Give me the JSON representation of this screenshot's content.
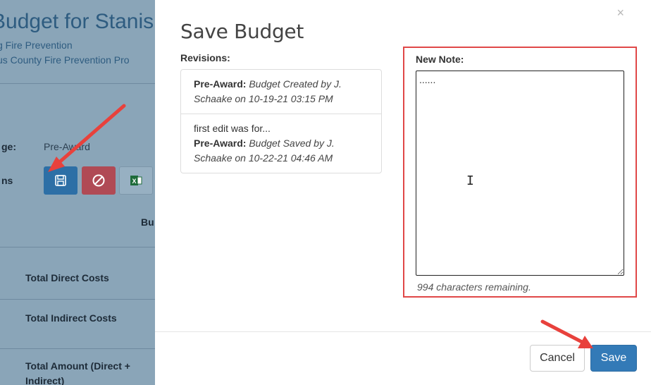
{
  "background": {
    "title": "Budget for Stanisl",
    "subtitle1": "g Fire Prevention",
    "subtitle2": "us County Fire Prevention Pro",
    "stage_label": "ge:",
    "stage_value": "Pre-Award",
    "actions_label": "ns",
    "column_header": "Bu",
    "rows": [
      "Total Direct Costs",
      "Total Indirect Costs",
      "Total Amount (Direct + Indirect)"
    ]
  },
  "modal": {
    "close": "×",
    "title": "Save Budget",
    "revisions_label": "Revisions:",
    "revisions": [
      {
        "note": "",
        "stage": "Pre-Award:",
        "text": "Budget Created by J. Schaake on 10-19-21 03:15 PM"
      },
      {
        "note": "first edit was for...",
        "stage": "Pre-Award:",
        "text": "Budget Saved by J. Schaake on 10-22-21 04:46 AM"
      }
    ],
    "new_note_label": "New Note:",
    "new_note_value": "......",
    "remaining_text": "994 characters remaining.",
    "cancel_label": "Cancel",
    "save_label": "Save"
  },
  "colors": {
    "primary": "#337ab7",
    "highlight": "#e04848",
    "arrow": "#e8413c",
    "danger_button": "#c24a4e"
  },
  "icons": {
    "save": "floppy-disk-icon",
    "cancel": "ban-icon",
    "excel": "excel-icon",
    "cursor": "text-cursor-icon"
  }
}
